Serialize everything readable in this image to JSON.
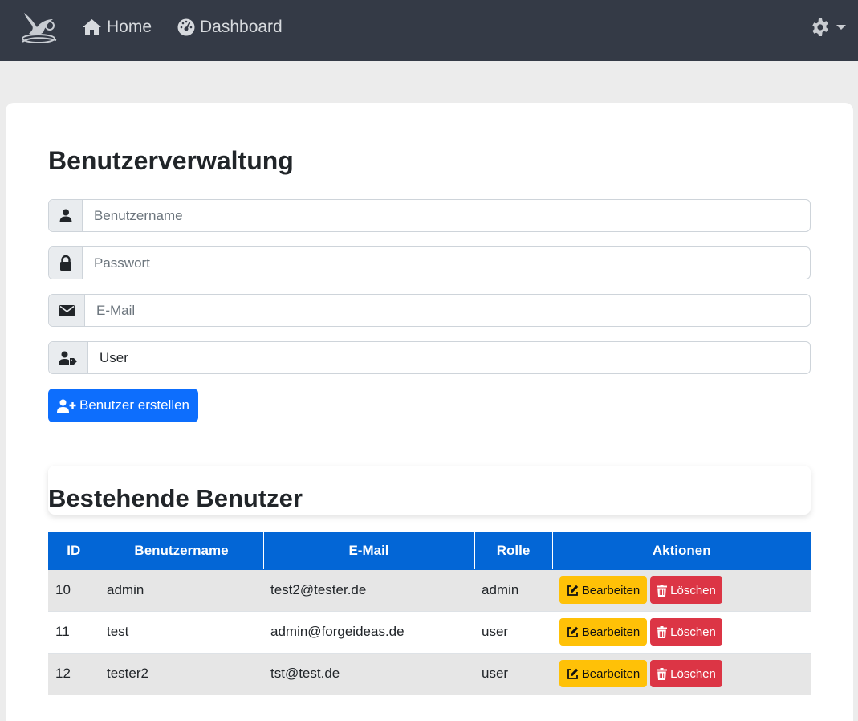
{
  "nav": {
    "home_label": "Home",
    "dashboard_label": "Dashboard"
  },
  "page": {
    "title": "Benutzerverwaltung"
  },
  "form": {
    "username_placeholder": "Benutzername",
    "password_placeholder": "Passwort",
    "email_placeholder": "E-Mail",
    "role_value": "User",
    "create_button_label": "Benutzer erstellen"
  },
  "users_section": {
    "title": "Bestehende Benutzer",
    "columns": [
      "ID",
      "Benutzername",
      "E-Mail",
      "Rolle",
      "Aktionen"
    ],
    "rows": [
      {
        "id": "10",
        "username": "admin",
        "email": "test2@tester.de",
        "role": "admin",
        "edit_label": "Bearbeiten",
        "delete_label": "Löschen"
      },
      {
        "id": "11",
        "username": "test",
        "email": "admin@forgeideas.de",
        "role": "user",
        "edit_label": "Bearbeiten",
        "delete_label": "Löschen"
      },
      {
        "id": "12",
        "username": "tester2",
        "email": "tst@test.de",
        "role": "user",
        "edit_label": "Bearbeiten",
        "delete_label": "Löschen"
      }
    ]
  },
  "colors": {
    "navbar": "#343a46",
    "primary": "#0d6efd",
    "table_header": "#0366d6",
    "warning": "#ffc107",
    "danger": "#dc3545"
  },
  "icons": {
    "brand": "bird-logo-icon",
    "home": "home-icon",
    "dashboard": "tachometer-icon",
    "settings": "gear-icon",
    "username": "user-icon",
    "password": "lock-icon",
    "email": "envelope-icon",
    "role": "user-tag-icon",
    "create": "user-plus-icon",
    "edit": "edit-icon",
    "delete": "trash-icon"
  }
}
